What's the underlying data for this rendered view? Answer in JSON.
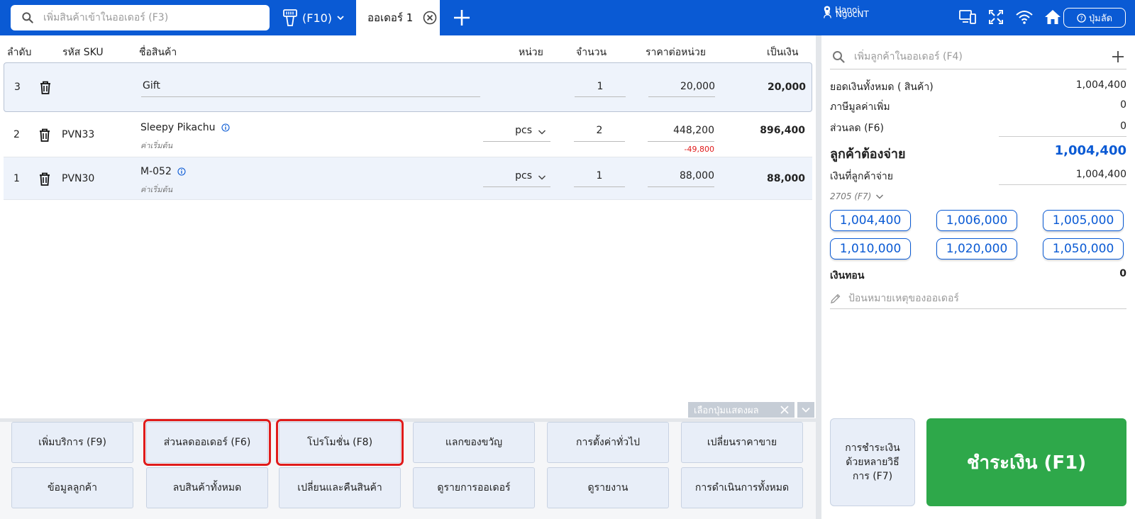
{
  "topbar": {
    "search_placeholder": "เพิ่มสินค้าเข้าในออเดอร์ (F3)",
    "scanner_label": "(F10)",
    "order_tab": "ออเดอร์ 1",
    "location": "Hanoi",
    "user": "NgocNT",
    "shortcut_label": "ปุ่มลัด"
  },
  "table": {
    "headers": {
      "index": "ลำดับ",
      "sku": "รหัส SKU",
      "name": "ชื่อสินค้า",
      "unit": "หน่วย",
      "qty": "จำนวน",
      "price": "ราคาต่อหน่วย",
      "total": "เป็นเงิน"
    },
    "rows": [
      {
        "index": "3",
        "sku": "",
        "name": "Gift",
        "sub": "",
        "unit": "",
        "qty": "1",
        "price": "20,000",
        "discount": "",
        "total": "20,000"
      },
      {
        "index": "2",
        "sku": "PVN33",
        "name": "Sleepy Pikachu",
        "sub": "ค่าเริ่มต้น",
        "unit": "pcs",
        "qty": "2",
        "price": "448,200",
        "discount": "-49,800",
        "total": "896,400"
      },
      {
        "index": "1",
        "sku": "PVN30",
        "name": "M-052",
        "sub": "ค่าเริ่มต้น",
        "unit": "pcs",
        "qty": "1",
        "price": "88,000",
        "discount": "",
        "total": "88,000"
      }
    ],
    "filter_chip": "เลือกปุ่มแสดงผล"
  },
  "function_buttons": [
    "เพิ่มบริการ (F9)",
    "ส่วนลดออเดอร์ (F6)",
    "โปรโมชั่น (F8)",
    "แลกของขวัญ",
    "การตั้งค่าทั่วไป",
    "เปลี่ยนราคาขาย",
    "ข้อมูลลูกค้า",
    "ลบสินค้าทั้งหมด",
    "เปลี่ยนและคืนสินค้า",
    "ดูรายการออเดอร์",
    "ดูรายงาน",
    "การดำเนินการทั้งหมด"
  ],
  "summary": {
    "customer_placeholder": "เพิ่มลูกค้าในออเดอร์ (F4)",
    "total_goods_label": "ยอดเงินทั้งหมด ( สินค้า)",
    "total_goods": "1,004,400",
    "vat_label": "ภาษีมูลค่าเพิ่ม",
    "vat": "0",
    "discount_label": "ส่วนลด (F6)",
    "discount": "0",
    "must_pay_label": "ลูกค้าต้องจ่าย",
    "must_pay": "1,004,400",
    "paid_label": "เงินที่ลูกค้าจ่าย",
    "paid": "1,004,400",
    "card_select": "2705 (F7)",
    "quick_amounts": [
      "1,004,400",
      "1,006,000",
      "1,005,000",
      "1,010,000",
      "1,020,000",
      "1,050,000"
    ],
    "change_label": "เงินทอน",
    "change": "0",
    "note_placeholder": "ป้อนหมายเหตุของออเดอร์",
    "multi_pay_label": "การชำระเงินด้วยหลายวิธีการ (F7)",
    "pay_label": "ชำระเงิน (F1)"
  }
}
